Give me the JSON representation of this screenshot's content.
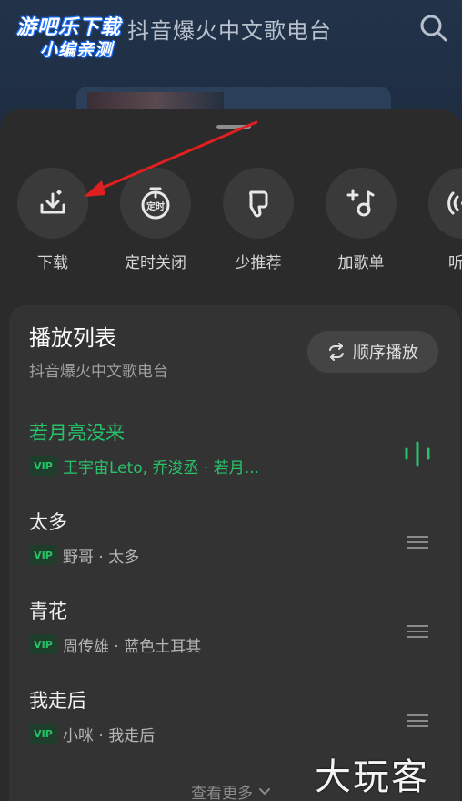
{
  "background": {
    "station_title": "抖音爆火中文歌电台"
  },
  "watermark": {
    "logo_line1": "游吧乐下载",
    "logo_line2": "小编亲测",
    "corner_text": "大玩客"
  },
  "actions": [
    {
      "label": "下载",
      "icon": "download-icon"
    },
    {
      "label": "定时关闭",
      "icon": "timer-icon",
      "icon_text": "定时"
    },
    {
      "label": "少推荐",
      "icon": "thumbs-down-icon"
    },
    {
      "label": "加歌单",
      "icon": "add-to-playlist-icon"
    },
    {
      "label": "听相",
      "icon": "broadcast-icon"
    }
  ],
  "playlist": {
    "title": "播放列表",
    "subtitle": "抖音爆火中文歌电台",
    "order_label": "顺序播放",
    "vip_label": "VIP",
    "songs": [
      {
        "name": "若月亮没来",
        "artist": "王宇宙Leto, 乔浚丞 · 若月...",
        "playing": true
      },
      {
        "name": "太多",
        "artist": "野哥 · 太多",
        "playing": false
      },
      {
        "name": "青花",
        "artist": "周传雄 · 蓝色土耳其",
        "playing": false
      },
      {
        "name": "我走后",
        "artist": "小咪 · 我走后",
        "playing": false
      }
    ],
    "more_label": "查看更多"
  },
  "colors": {
    "accent_green": "#27c36a",
    "sheet_bg": "#2b2b2b",
    "annotation_red": "#e02020"
  }
}
